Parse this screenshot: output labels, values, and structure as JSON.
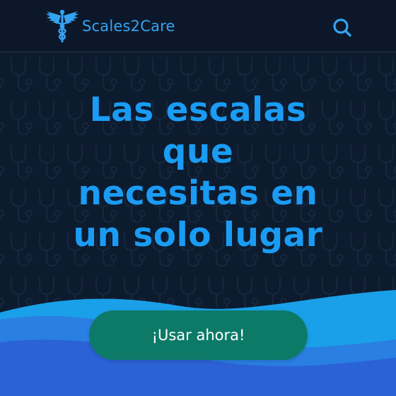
{
  "brand": {
    "name": "Scales2Care",
    "logo_icon": "caduceus-icon"
  },
  "header": {
    "search_icon": "search-icon"
  },
  "hero": {
    "headline_lines": [
      "Las escalas",
      "que",
      "necesitas en",
      "un solo lugar"
    ],
    "background_pattern": "stethoscope-icon"
  },
  "cta": {
    "label": "¡Usar ahora!"
  },
  "colors": {
    "background": "#0d1b2e",
    "accent": "#1a9cf4",
    "brand_text": "#35a3f2",
    "cta_background": "#0d7a68",
    "wave_light": "#1aa0e8",
    "wave_dark": "#2b62d6"
  }
}
